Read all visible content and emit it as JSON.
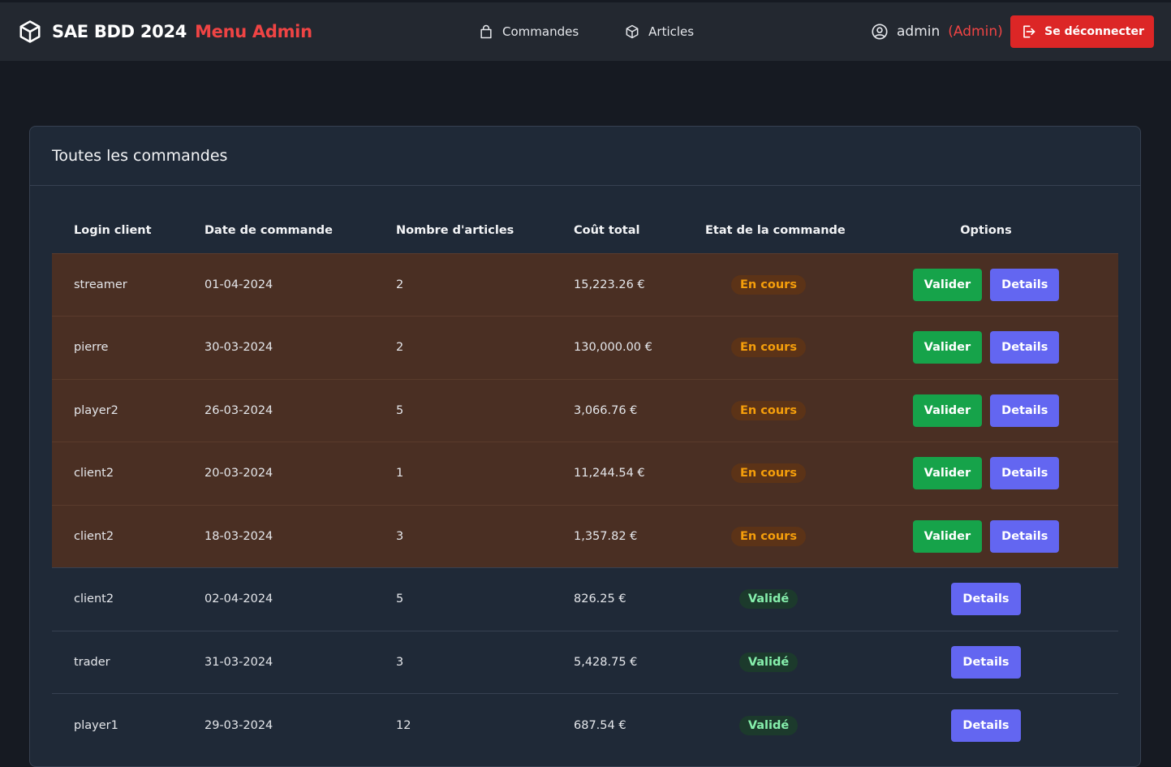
{
  "header": {
    "title": "SAE BDD 2024",
    "subtitle": "Menu Admin",
    "nav": [
      {
        "label": "Commandes",
        "icon": "bag-icon"
      },
      {
        "label": "Articles",
        "icon": "box-icon"
      }
    ],
    "user": {
      "name": "admin",
      "role": "(Admin)"
    },
    "logout_label": "Se déconnecter"
  },
  "card": {
    "title": "Toutes les commandes",
    "columns": [
      "Login client",
      "Date de commande",
      "Nombre d'articles",
      "Coût total",
      "Etat de la commande",
      "Options"
    ],
    "actions": {
      "validate": "Valider",
      "details": "Details"
    },
    "rows": [
      {
        "login": "streamer",
        "date": "01-04-2024",
        "count": "2",
        "total": "15,223.26 €",
        "status": "En cours",
        "state": "pending"
      },
      {
        "login": "pierre",
        "date": "30-03-2024",
        "count": "2",
        "total": "130,000.00 €",
        "status": "En cours",
        "state": "pending"
      },
      {
        "login": "player2",
        "date": "26-03-2024",
        "count": "5",
        "total": "3,066.76 €",
        "status": "En cours",
        "state": "pending"
      },
      {
        "login": "client2",
        "date": "20-03-2024",
        "count": "1",
        "total": "11,244.54 €",
        "status": "En cours",
        "state": "pending"
      },
      {
        "login": "client2",
        "date": "18-03-2024",
        "count": "3",
        "total": "1,357.82 €",
        "status": "En cours",
        "state": "pending"
      },
      {
        "login": "client2",
        "date": "02-04-2024",
        "count": "5",
        "total": "826.25 €",
        "status": "Validé",
        "state": "done"
      },
      {
        "login": "trader",
        "date": "31-03-2024",
        "count": "3",
        "total": "5,428.75 €",
        "status": "Validé",
        "state": "done"
      },
      {
        "login": "player1",
        "date": "29-03-2024",
        "count": "12",
        "total": "687.54 €",
        "status": "Validé",
        "state": "done"
      }
    ]
  },
  "colors": {
    "brand_accent": "#ef4444",
    "logout": "#dc2626",
    "validate": "#16a34a",
    "details": "#6366f1",
    "pending_row": "#4a2f23"
  }
}
